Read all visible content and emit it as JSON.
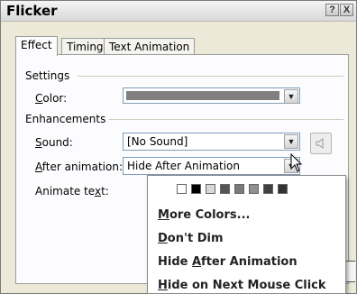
{
  "window": {
    "title": "Flicker",
    "help_glyph": "?",
    "close_glyph": "X"
  },
  "tabs": [
    {
      "label": "Effect",
      "active": true
    },
    {
      "label": "Timing",
      "active": false
    },
    {
      "label": "Text Animation",
      "active": false
    }
  ],
  "settings": {
    "group_label": "Settings",
    "color_label_pre": "",
    "color_label_u": "C",
    "color_label_post": "olor:",
    "color_value_hex": "#808080"
  },
  "enhancements": {
    "group_label": "Enhancements",
    "sound_label_u": "S",
    "sound_label_post": "ound:",
    "sound_value": "[No Sound]",
    "after_label_u": "A",
    "after_label_post": "fter animation:",
    "after_value": "Hide After Animation",
    "animate_label_pre": "Animate te",
    "animate_label_u": "x",
    "animate_label_post": "t:"
  },
  "dropdown_menu": {
    "swatch_colors": [
      "#ffffff",
      "#000000",
      "#d8d8d8",
      "#555555",
      "#7a7a7a",
      "#909090",
      "#404040",
      "#333333"
    ],
    "items": [
      {
        "u": "M",
        "rest": "ore Colors..."
      },
      {
        "u": "D",
        "rest": "on't Dim"
      },
      {
        "pre": "Hide ",
        "u": "A",
        "rest": "fter Animation"
      },
      {
        "u": "H",
        "rest": "ide on Next Mouse Click"
      }
    ]
  }
}
